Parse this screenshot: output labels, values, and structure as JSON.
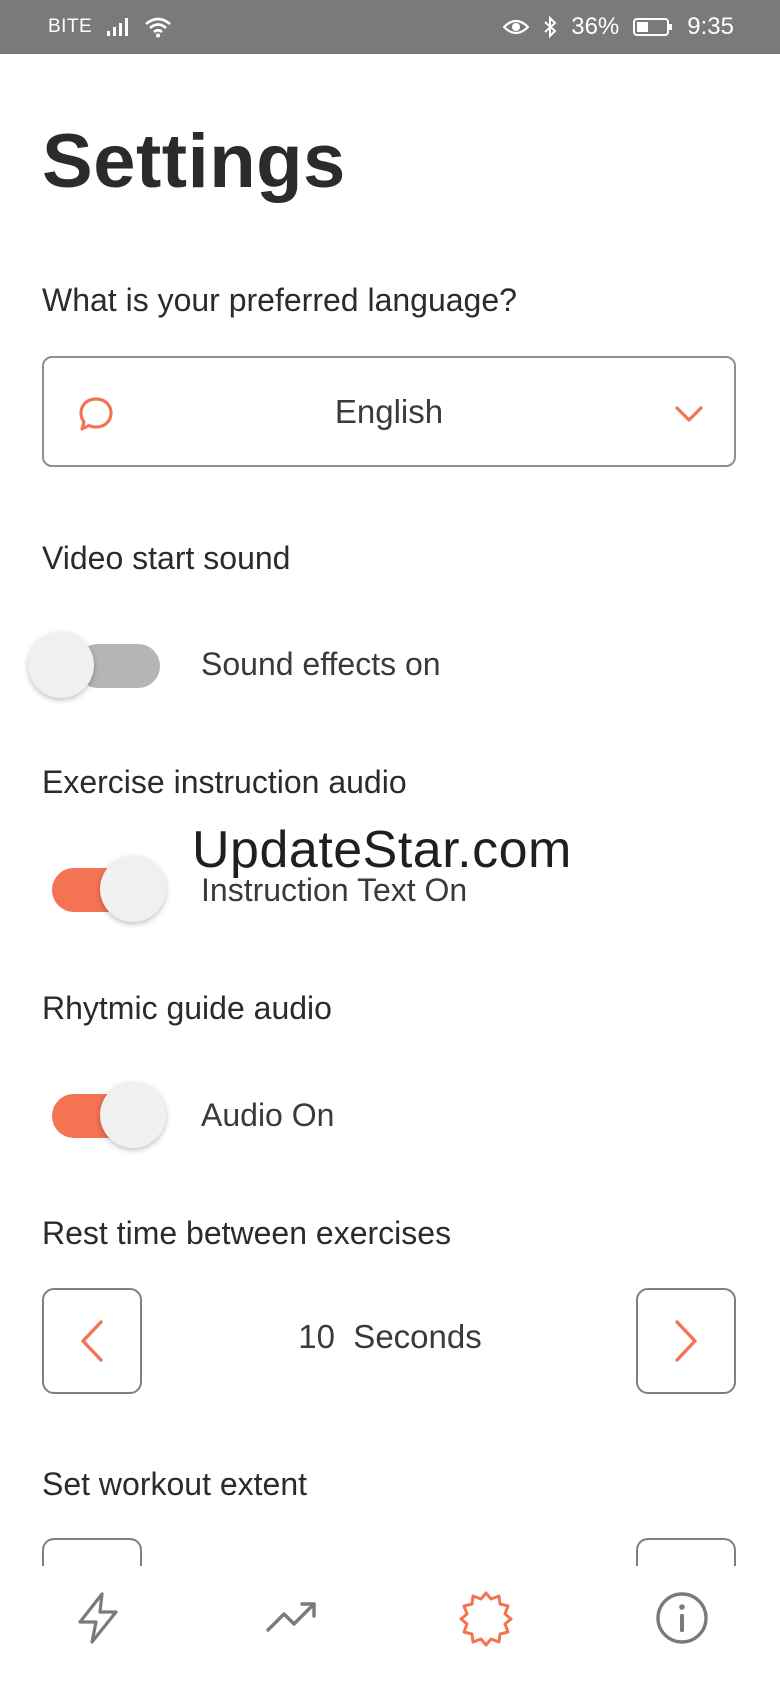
{
  "status_bar": {
    "carrier": "BITE",
    "battery": "36%",
    "time": "9:35"
  },
  "page": {
    "title": "Settings"
  },
  "language": {
    "label": "What is your preferred language?",
    "value": "English"
  },
  "video_sound": {
    "label": "Video start sound",
    "toggle_text": "Sound effects on",
    "enabled": false
  },
  "instruction_audio": {
    "label": "Exercise instruction audio",
    "toggle_text": "Instruction Text On",
    "enabled": true
  },
  "rhythmic_audio": {
    "label": "Rhytmic guide audio",
    "toggle_text": "Audio On",
    "enabled": true
  },
  "rest_time": {
    "label": "Rest time between exercises",
    "value": "10  Seconds"
  },
  "workout_extent": {
    "label": "Set workout extent"
  },
  "watermark": "UpdateStar.com",
  "colors": {
    "accent": "#f47352",
    "text": "#2b2b2b",
    "status_bar": "#7a7a7a"
  },
  "nav": {
    "items": [
      "bolt-icon",
      "trend-icon",
      "gear-icon",
      "info-icon"
    ],
    "active": "gear-icon"
  }
}
